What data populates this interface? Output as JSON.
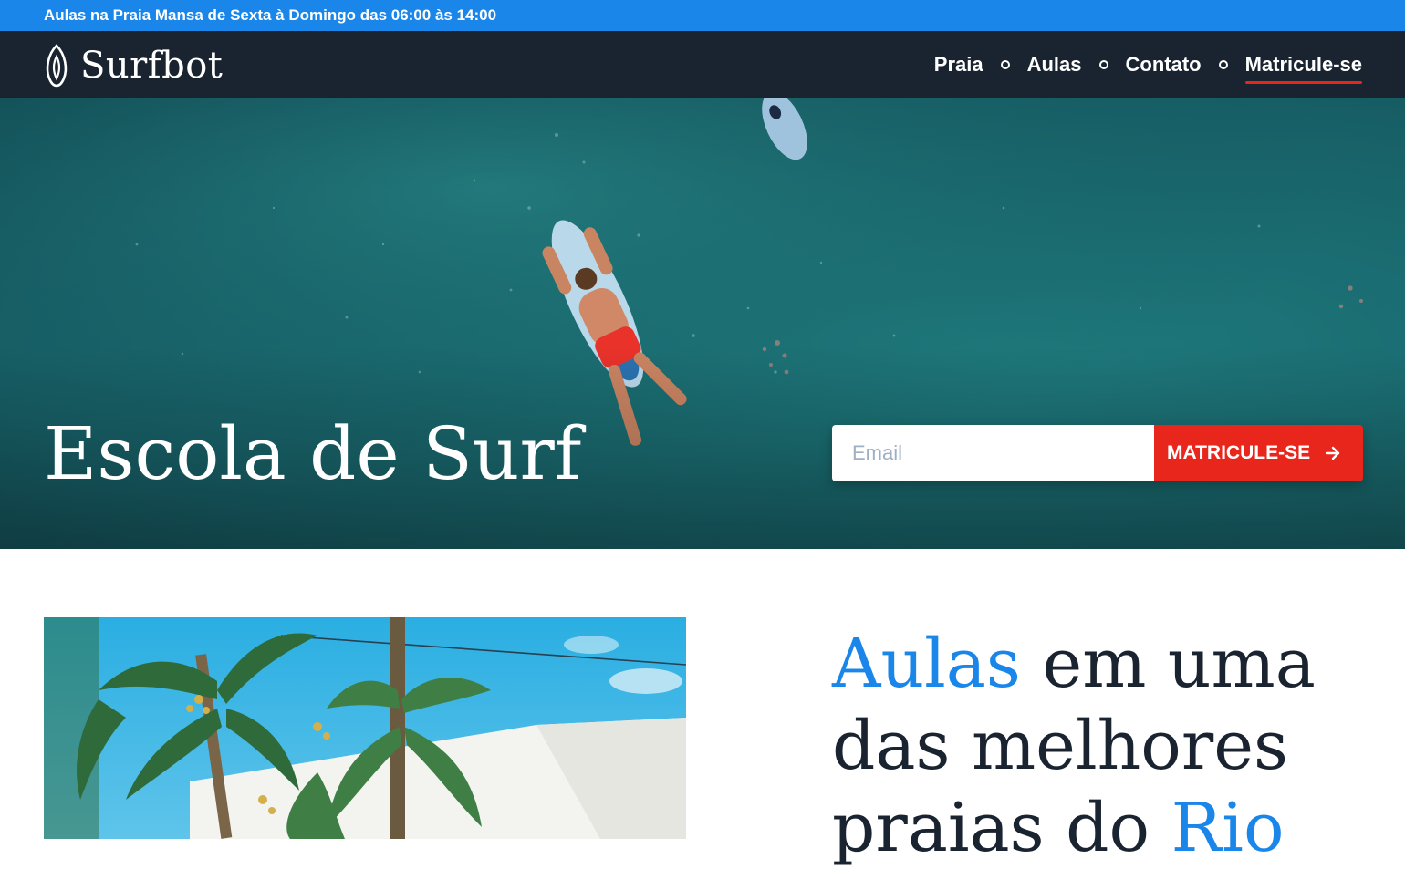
{
  "announcement": "Aulas na Praia Mansa de Sexta à Domingo das 06:00 às 14:00",
  "brand": {
    "name": "Surfbot",
    "icon": "surfboard-icon"
  },
  "nav": {
    "items": [
      {
        "label": "Praia"
      },
      {
        "label": "Aulas"
      },
      {
        "label": "Contato"
      },
      {
        "label": "Matricule-se",
        "active": true
      }
    ]
  },
  "hero": {
    "title": "Escola de Surf",
    "email_placeholder": "Email",
    "cta_label": "MATRICULE-SE",
    "cta_icon": "arrow-right-icon"
  },
  "section": {
    "heading_accent_1": "Aulas",
    "heading_part_1": " em uma das melhores praias do ",
    "heading_accent_2": "Rio"
  },
  "colors": {
    "announcement_bg": "#1a86ea",
    "header_bg": "#1a2330",
    "cta_bg": "#e8261c",
    "accent": "#1a86ea",
    "heading": "#1a2330"
  }
}
